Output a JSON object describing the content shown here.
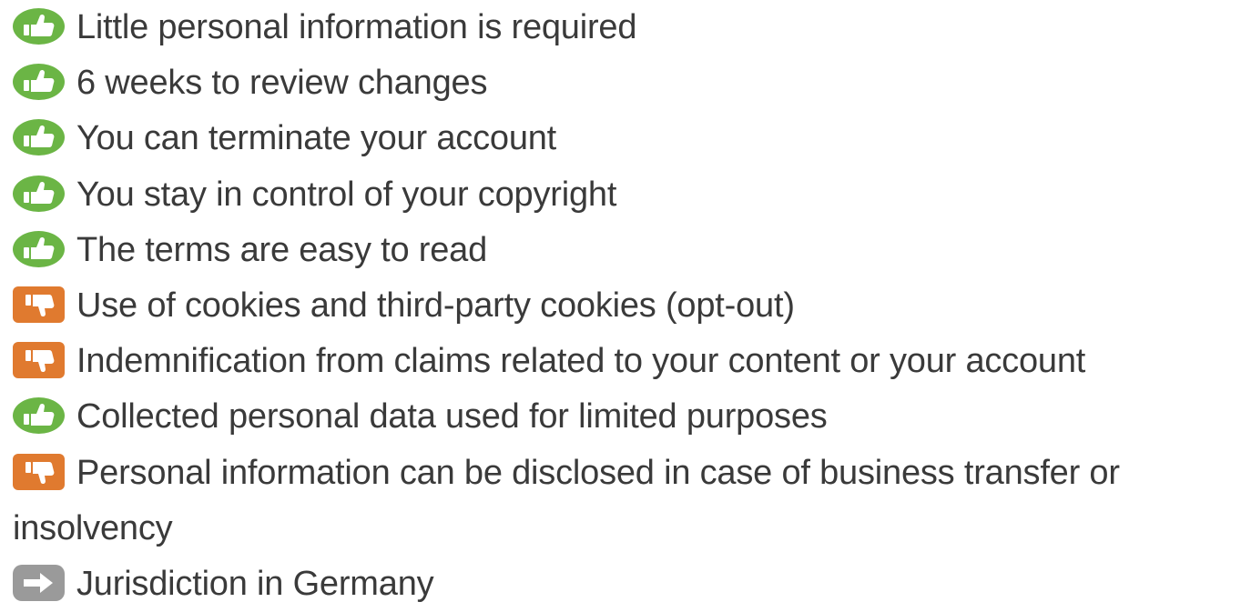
{
  "colors": {
    "good": "#6bb545",
    "bad": "#e07a2f",
    "neutral": "#9a9a9a",
    "text": "#3a3a3a"
  },
  "items": [
    {
      "rating": "good",
      "icon": "thumbs-up-icon",
      "text": "Little personal information is required"
    },
    {
      "rating": "good",
      "icon": "thumbs-up-icon",
      "text": "6 weeks to review changes"
    },
    {
      "rating": "good",
      "icon": "thumbs-up-icon",
      "text": "You can terminate your account"
    },
    {
      "rating": "good",
      "icon": "thumbs-up-icon",
      "text": "You stay in control of your copyright"
    },
    {
      "rating": "good",
      "icon": "thumbs-up-icon",
      "text": "The terms are easy to read"
    },
    {
      "rating": "bad",
      "icon": "thumbs-down-icon",
      "text": "Use of cookies and third-party cookies (opt-out)"
    },
    {
      "rating": "bad",
      "icon": "thumbs-down-icon",
      "text": "Indemnification from claims related to your content or your account"
    },
    {
      "rating": "good",
      "icon": "thumbs-up-icon",
      "text": "Collected personal data used for limited purposes"
    },
    {
      "rating": "bad",
      "icon": "thumbs-down-icon",
      "text": "Personal information can be disclosed in case of business transfer or insolvency"
    },
    {
      "rating": "neutral",
      "icon": "arrow-right-icon",
      "text": "Jurisdiction in Germany"
    }
  ]
}
